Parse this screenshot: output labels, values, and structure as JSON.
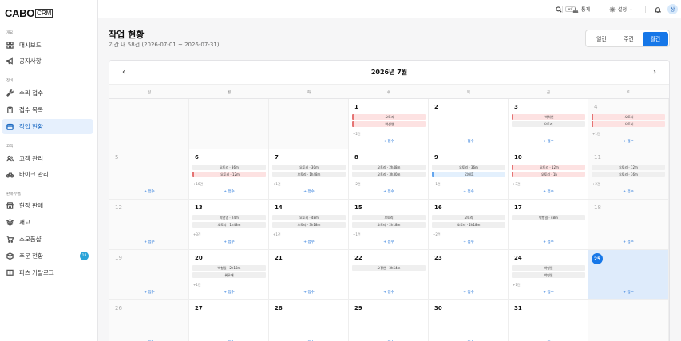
{
  "app": {
    "logo_main": "CABO",
    "logo_sub": "CRM"
  },
  "sidebar": {
    "sections": [
      {
        "label": "개요"
      },
      {
        "label": "정비"
      },
      {
        "label": "고객"
      },
      {
        "label": "판매·부품"
      }
    ],
    "items": [
      {
        "label": "대시보드",
        "icon": "grid-icon"
      },
      {
        "label": "공지사항",
        "icon": "megaphone-icon"
      },
      {
        "label": "수리 접수",
        "icon": "wrench-icon"
      },
      {
        "label": "접수 목록",
        "icon": "clipboard-icon"
      },
      {
        "label": "작업 현황",
        "icon": "calendar-icon"
      },
      {
        "label": "고객 관리",
        "icon": "users-icon"
      },
      {
        "label": "바이크 관리",
        "icon": "bike-icon"
      },
      {
        "label": "현장 판매",
        "icon": "shop-icon"
      },
      {
        "label": "재고",
        "icon": "layers-icon"
      },
      {
        "label": "소모품샵",
        "icon": "cart-icon"
      },
      {
        "label": "주문 현황",
        "icon": "box-icon",
        "badge": "18"
      },
      {
        "label": "파츠 카탈로그",
        "icon": "book-icon"
      }
    ]
  },
  "topbar": {
    "search_shortcut": "⌘K",
    "stats_label": "통계",
    "settings_label": "설정",
    "avatar_initial": "상"
  },
  "page": {
    "title": "작업 현황",
    "subtitle": "기간 내 58건 (2026-07-01 ~ 2026-07-31)",
    "view_tabs": [
      "일간",
      "주간",
      "월간"
    ],
    "active_view": "월간"
  },
  "calendar": {
    "month_title": "2026년 7월",
    "weekdays": [
      "일",
      "월",
      "화",
      "수",
      "목",
      "금",
      "토"
    ],
    "add_label": "+ 접수",
    "accent_color": "#1677e8",
    "weeks": [
      [
        {
          "day": "",
          "dim": true,
          "events": []
        },
        {
          "day": "",
          "dim": true,
          "events": []
        },
        {
          "day": "",
          "dim": true,
          "events": []
        },
        {
          "day": "1",
          "events": [
            {
              "t": "오토리",
              "c": "red"
            },
            {
              "t": "박선영",
              "c": "red"
            }
          ],
          "more": "+2건"
        },
        {
          "day": "2",
          "events": []
        },
        {
          "day": "3",
          "events": [
            {
              "t": "박희연",
              "c": "red"
            },
            {
              "t": "오토리",
              "c": "gray"
            }
          ]
        },
        {
          "day": "4",
          "dim": true,
          "events": [
            {
              "t": "오토리",
              "c": "red"
            },
            {
              "t": "오토리",
              "c": "red"
            }
          ],
          "more": "+1건"
        }
      ],
      [
        {
          "day": "5",
          "dim": true,
          "events": []
        },
        {
          "day": "6",
          "events": [
            {
              "t": "오토리 · 36m",
              "c": "gray"
            },
            {
              "t": "오토리 · 12m",
              "c": "red"
            }
          ],
          "more": "+16건"
        },
        {
          "day": "7",
          "events": [
            {
              "t": "오토리 · 30m",
              "c": "gray"
            },
            {
              "t": "오토리 · 1h48m",
              "c": "gray"
            }
          ],
          "more": "+1건"
        },
        {
          "day": "8",
          "events": [
            {
              "t": "오토리 · 2h48m",
              "c": "gray"
            },
            {
              "t": "오토리 · 3h30m",
              "c": "gray"
            }
          ],
          "more": "+2건"
        },
        {
          "day": "9",
          "events": [
            {
              "t": "오토리 · 36m",
              "c": "gray"
            },
            {
              "t": "김태훈",
              "c": "blue"
            }
          ],
          "more": "+1건"
        },
        {
          "day": "10",
          "events": [
            {
              "t": "오토리 · 12m",
              "c": "red"
            },
            {
              "t": "오토리 · 1h",
              "c": "red"
            }
          ],
          "more": "+3건"
        },
        {
          "day": "11",
          "dim": true,
          "events": [
            {
              "t": "오토리 · 12m",
              "c": "gray"
            },
            {
              "t": "오토리 · 36m",
              "c": "gray"
            }
          ],
          "more": "+2건"
        }
      ],
      [
        {
          "day": "12",
          "dim": true,
          "events": []
        },
        {
          "day": "13",
          "events": [
            {
              "t": "박선영 · 24m",
              "c": "gray"
            },
            {
              "t": "오토리 · 1h48m",
              "c": "gray"
            }
          ],
          "more": "+3건"
        },
        {
          "day": "14",
          "events": [
            {
              "t": "오토리 · 48m",
              "c": "gray"
            },
            {
              "t": "오토리 · 3h18m",
              "c": "gray"
            }
          ],
          "more": "+1건"
        },
        {
          "day": "15",
          "events": [
            {
              "t": "오토리",
              "c": "gray"
            },
            {
              "t": "오토리 · 2h18m",
              "c": "gray"
            }
          ],
          "more": "+1건"
        },
        {
          "day": "16",
          "events": [
            {
              "t": "오토리",
              "c": "gray"
            },
            {
              "t": "오토리 · 2h18m",
              "c": "gray"
            }
          ],
          "more": "+2건"
        },
        {
          "day": "17",
          "events": [
            {
              "t": "박형일 · 48m",
              "c": "gray"
            }
          ]
        },
        {
          "day": "18",
          "dim": true,
          "events": []
        }
      ],
      [
        {
          "day": "19",
          "dim": true,
          "events": []
        },
        {
          "day": "20",
          "events": [
            {
              "t": "박형일 · 2h18m",
              "c": "gray"
            },
            {
              "t": "위우재",
              "c": "gray"
            }
          ],
          "more": "+1건"
        },
        {
          "day": "21",
          "events": []
        },
        {
          "day": "22",
          "events": [
            {
              "t": "오정연 · 3h54m",
              "c": "gray"
            }
          ]
        },
        {
          "day": "23",
          "events": []
        },
        {
          "day": "24",
          "events": [
            {
              "t": "박형일",
              "c": "gray"
            },
            {
              "t": "박형일",
              "c": "gray"
            }
          ],
          "more": "+1건"
        },
        {
          "day": "25",
          "today": true,
          "events": []
        }
      ],
      [
        {
          "day": "26",
          "dim": true,
          "events": []
        },
        {
          "day": "27",
          "events": []
        },
        {
          "day": "28",
          "events": []
        },
        {
          "day": "29",
          "events": []
        },
        {
          "day": "30",
          "events": []
        },
        {
          "day": "31",
          "events": []
        },
        {
          "day": "",
          "dim": true,
          "events": []
        }
      ]
    ]
  }
}
